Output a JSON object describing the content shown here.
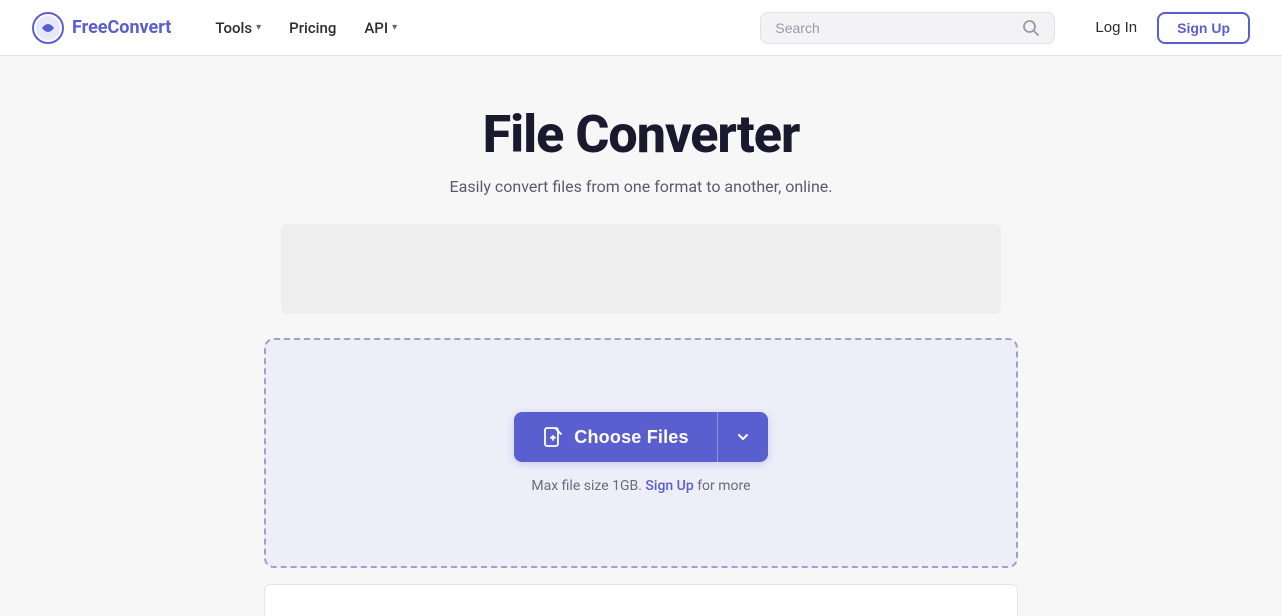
{
  "nav": {
    "logo": {
      "free": "Free",
      "convert": "Convert"
    },
    "links": [
      {
        "id": "tools",
        "label": "Tools",
        "hasDropdown": true
      },
      {
        "id": "pricing",
        "label": "Pricing",
        "hasDropdown": false
      },
      {
        "id": "api",
        "label": "API",
        "hasDropdown": true
      }
    ],
    "search": {
      "placeholder": "Search"
    },
    "login_label": "Log In",
    "signup_label": "Sign Up"
  },
  "main": {
    "title": "File Converter",
    "subtitle": "Easily convert files from one format to another, online.",
    "choose_files_label": "Choose Files",
    "file_size_note": "Max file size 1GB.",
    "signup_link_label": "Sign Up",
    "file_size_suffix": " for more",
    "chevron_down": "▾",
    "file_icon": "⊕"
  }
}
